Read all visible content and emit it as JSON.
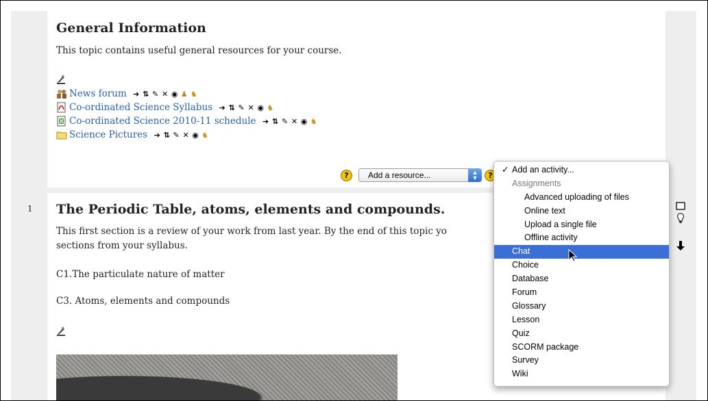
{
  "section0": {
    "title": "General Information",
    "summary": "This topic contains useful general resources for your course.",
    "activities": [
      {
        "name": "News forum",
        "icon": "forum-icon"
      },
      {
        "name": "Co-ordinated Science Syllabus",
        "icon": "pdf-icon"
      },
      {
        "name": "Co-ordinated Science 2010-11 schedule",
        "icon": "spreadsheet-icon"
      },
      {
        "name": "Science Pictures",
        "icon": "folder-icon"
      }
    ],
    "add_resource_label": "Add a resource...",
    "help_glyph": "?"
  },
  "section1": {
    "number": "1",
    "title": "The Periodic Table, atoms, elements and compounds.",
    "summary": "This first section is a review of your work from last year. By the end of this topic you will understand the following sections from your syllabus.",
    "summary_visible_a": "This first section is a review of your work from last year. By the end of this topic yo",
    "summary_visible_b": "sections from your syllabus.",
    "item_c1": "C1.The particulate nature of matter",
    "item_c3": "C3. Atoms, elements and compounds"
  },
  "activity_menu": {
    "items": [
      {
        "label": "Add an activity...",
        "kind": "checked"
      },
      {
        "label": "Assignments",
        "kind": "group"
      },
      {
        "label": "Advanced uploading of files",
        "kind": "sub"
      },
      {
        "label": "Online text",
        "kind": "sub"
      },
      {
        "label": "Upload a single file",
        "kind": "sub"
      },
      {
        "label": "Offline activity",
        "kind": "sub"
      },
      {
        "label": "Chat",
        "kind": "selected"
      },
      {
        "label": "Choice",
        "kind": "item"
      },
      {
        "label": "Database",
        "kind": "item"
      },
      {
        "label": "Forum",
        "kind": "item"
      },
      {
        "label": "Glossary",
        "kind": "item"
      },
      {
        "label": "Lesson",
        "kind": "item"
      },
      {
        "label": "Quiz",
        "kind": "item"
      },
      {
        "label": "SCORM package",
        "kind": "item"
      },
      {
        "label": "Survey",
        "kind": "item"
      },
      {
        "label": "Wiki",
        "kind": "item"
      }
    ],
    "check_glyph": "✓"
  },
  "colors": {
    "link": "#2a5eaa",
    "selected": "#3b6fd6",
    "help_yellow": "#f5c400"
  }
}
